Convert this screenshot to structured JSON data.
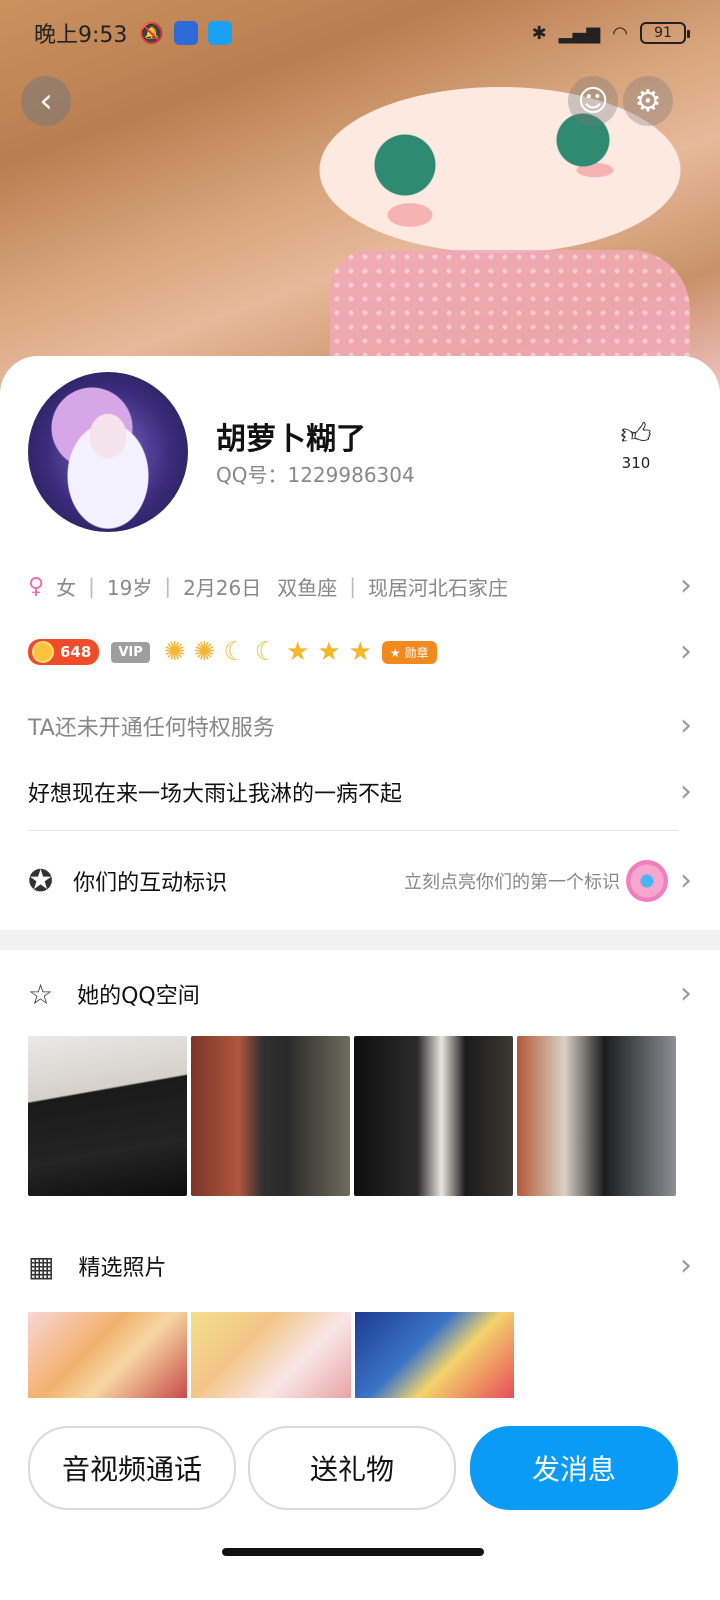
{
  "status_bar": {
    "time": "晚上9:53",
    "battery": "91"
  },
  "profile": {
    "nickname": "胡萝卜糊了",
    "qq_label": "QQ号：1229986304",
    "likes": "310"
  },
  "info": {
    "gender": "女",
    "age": "19岁",
    "birthday": "2月26日",
    "zodiac": "双鱼座",
    "location": "现居河北石家庄"
  },
  "level": {
    "number": "648",
    "vip": "VIP",
    "medal": "勋章"
  },
  "privilege_text": "TA还未开通任何特权服务",
  "signature": "好想现在来一场大雨让我淋的一病不起",
  "interaction": {
    "title": "你们的互动标识",
    "hint": "立刻点亮你们的第一个标识"
  },
  "qzone": {
    "title": "她的QQ空间"
  },
  "featured": {
    "title": "精选照片"
  },
  "actions": {
    "call": "音视频通话",
    "gift": "送礼物",
    "send": "发消息"
  },
  "colors": {
    "accent": "#0a9bf7",
    "gender_icon": "#f26ea0",
    "level_badge": "#f04b2a"
  }
}
